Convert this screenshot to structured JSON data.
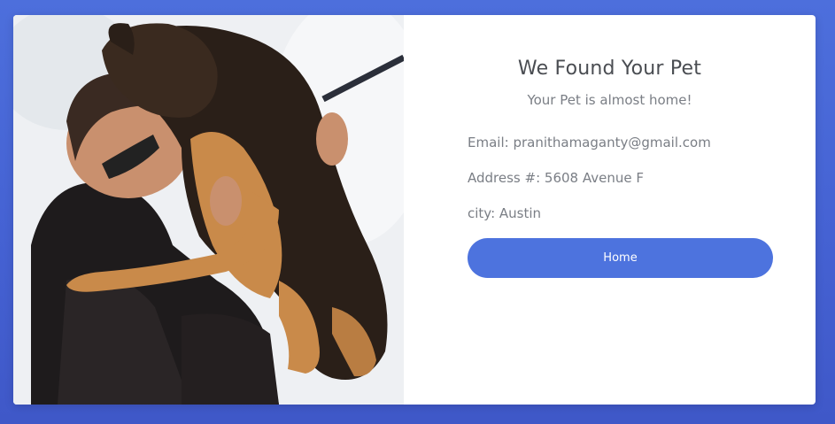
{
  "photo": {
    "alt": "Man hugging a German Shepherd dog in the snow"
  },
  "info": {
    "title": "We Found Your Pet",
    "subtitle": "Your Pet is almost home!",
    "email": "Email: pranithamaganty@gmail.com",
    "address": "Address #: 5608 Avenue F",
    "city": "city: Austin",
    "home_button": "Home"
  },
  "colors": {
    "background": "#4562d3",
    "button": "#4d73de",
    "title_text": "#4a4d52",
    "body_text": "#7a7e85"
  }
}
